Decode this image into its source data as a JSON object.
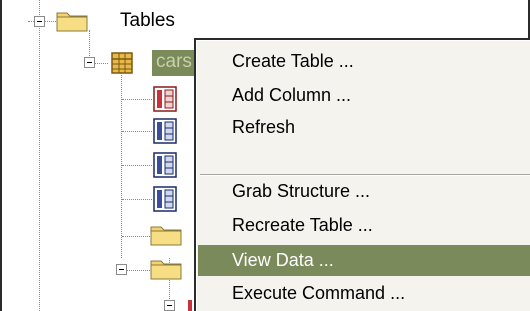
{
  "tree": {
    "tables_label": "Tables",
    "cars_label": "cars"
  },
  "context_menu": {
    "items": [
      {
        "label": "Create Table ..."
      },
      {
        "label": "Add Column ..."
      },
      {
        "label": "Refresh"
      },
      {
        "label": "Grab Structure ..."
      },
      {
        "label": "Recreate Table ..."
      },
      {
        "label": "View Data ..."
      },
      {
        "label": "Execute Command ..."
      }
    ],
    "selected": "View Data ..."
  },
  "colors": {
    "selection": "#7a8a5b",
    "menu_background": "#f4f3ee",
    "folder_yellow": "#f3d36b"
  }
}
